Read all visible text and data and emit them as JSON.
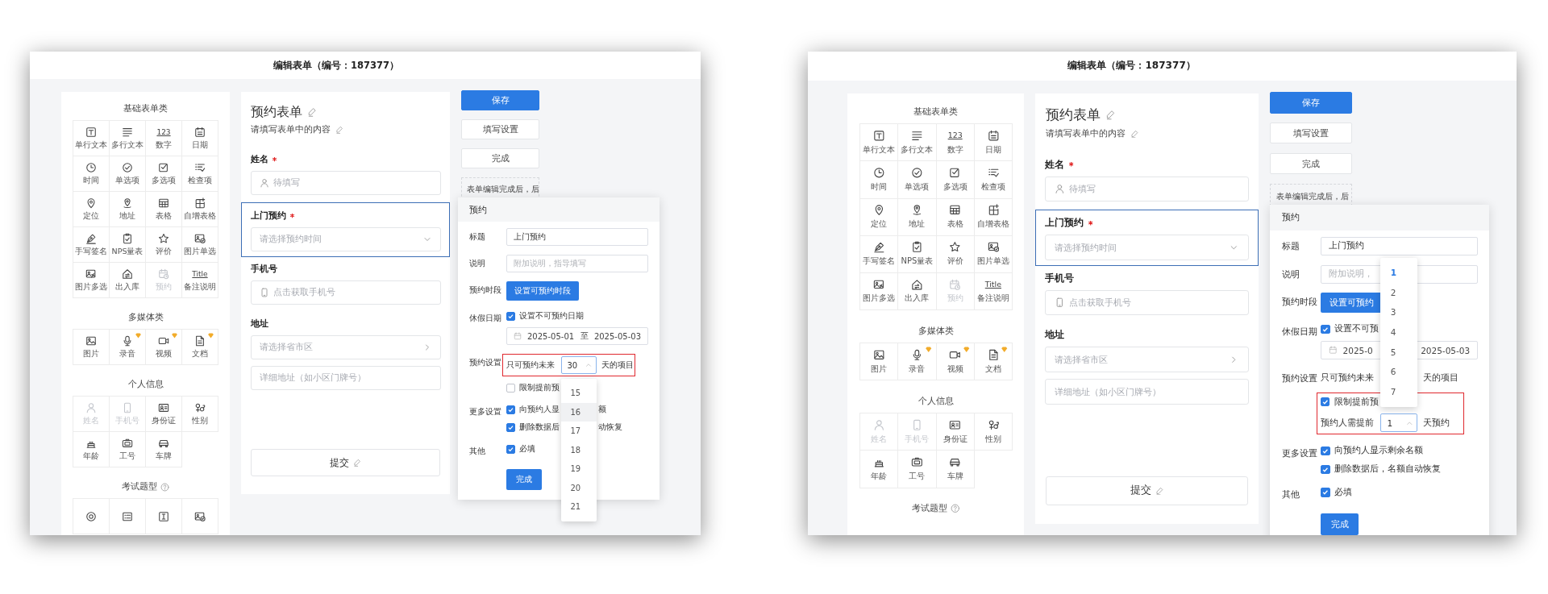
{
  "screens": [
    {
      "title": "编辑表单（编号：187377）",
      "sidebar": {
        "sections": [
          {
            "title": "基础表单类",
            "help": false,
            "items": [
              {
                "label": "单行文本",
                "kind": "text",
                "disabled": false,
                "premium": false
              },
              {
                "label": "多行文本",
                "kind": "textarea",
                "disabled": false,
                "premium": false
              },
              {
                "label": "数字",
                "glyph": "123",
                "disabled": false,
                "premium": false
              },
              {
                "label": "日期",
                "kind": "date",
                "disabled": false,
                "premium": false
              },
              {
                "label": "时间",
                "kind": "time",
                "disabled": false,
                "premium": false
              },
              {
                "label": "单选项",
                "kind": "radio",
                "disabled": false,
                "premium": false
              },
              {
                "label": "多选项",
                "kind": "checkbox",
                "disabled": false,
                "premium": false
              },
              {
                "label": "检查项",
                "kind": "checklist",
                "disabled": false,
                "premium": false
              },
              {
                "label": "定位",
                "kind": "location",
                "disabled": false,
                "premium": false
              },
              {
                "label": "地址",
                "kind": "address",
                "disabled": false,
                "premium": false
              },
              {
                "label": "表格",
                "kind": "table",
                "disabled": false,
                "premium": false
              },
              {
                "label": "自增表格",
                "kind": "add-table",
                "disabled": false,
                "premium": false
              },
              {
                "label": "手写签名",
                "kind": "signature",
                "disabled": false,
                "premium": false
              },
              {
                "label": "NPS量表",
                "kind": "nps",
                "disabled": false,
                "premium": false
              },
              {
                "label": "评价",
                "kind": "rating",
                "disabled": false,
                "premium": false
              },
              {
                "label": "图片单选",
                "kind": "image-radio",
                "disabled": false,
                "premium": false
              },
              {
                "label": "图片多选",
                "kind": "image-multi",
                "disabled": false,
                "premium": false
              },
              {
                "label": "出入库",
                "kind": "inventory",
                "disabled": false,
                "premium": false
              },
              {
                "label": "预约",
                "kind": "appointment",
                "disabled": true,
                "premium": false
              },
              {
                "label": "备注说明",
                "glyph": "Title",
                "disabled": false,
                "premium": false
              }
            ]
          },
          {
            "title": "多媒体类",
            "help": false,
            "items": [
              {
                "label": "图片",
                "kind": "image",
                "disabled": false,
                "premium": false
              },
              {
                "label": "录音",
                "kind": "audio",
                "disabled": false,
                "premium": true
              },
              {
                "label": "视频",
                "kind": "video",
                "disabled": false,
                "premium": true
              },
              {
                "label": "文档",
                "kind": "document",
                "disabled": false,
                "premium": true
              }
            ]
          },
          {
            "title": "个人信息",
            "help": false,
            "items": [
              {
                "label": "姓名",
                "kind": "person",
                "disabled": true,
                "premium": false
              },
              {
                "label": "手机号",
                "kind": "phone",
                "disabled": true,
                "premium": false
              },
              {
                "label": "身份证",
                "kind": "id-card",
                "disabled": false,
                "premium": false
              },
              {
                "label": "性别",
                "kind": "gender",
                "disabled": false,
                "premium": false
              },
              {
                "label": "年龄",
                "kind": "age",
                "disabled": false,
                "premium": false
              },
              {
                "label": "工号",
                "kind": "employee-id",
                "disabled": false,
                "premium": false
              },
              {
                "label": "车牌",
                "kind": "car",
                "disabled": false,
                "premium": false
              }
            ]
          },
          {
            "title": "考试题型",
            "help": true,
            "items": [
              {
                "kind": "exam-radio",
                "disabled": false,
                "premium": false
              },
              {
                "kind": "exam-multi",
                "disabled": false,
                "premium": false
              },
              {
                "kind": "fill-blank",
                "disabled": false,
                "premium": false
              },
              {
                "kind": "exam-image",
                "disabled": false,
                "premium": false
              }
            ]
          }
        ]
      },
      "form": {
        "title": "预约表单",
        "subtitle": "请填写表单中的内容",
        "fields": [
          {
            "label": "姓名",
            "required": true,
            "selected": false,
            "inputs": [
              {
                "kind": "person",
                "placeholder": "待填写"
              }
            ]
          },
          {
            "label": "上门预约",
            "required": true,
            "selected": true,
            "inputs": [
              {
                "kind": "select",
                "placeholder": "请选择预约时间"
              }
            ]
          },
          {
            "label": "手机号",
            "required": false,
            "selected": false,
            "inputs": [
              {
                "kind": "phone",
                "placeholder": "点击获取手机号"
              }
            ]
          },
          {
            "label": "地址",
            "required": false,
            "selected": false,
            "inputs": [
              {
                "kind": "region",
                "placeholder": "请选择省市区"
              },
              {
                "kind": "text",
                "placeholder": "详细地址（如小区门牌号）"
              }
            ]
          }
        ],
        "submit": "提交"
      },
      "actions": [
        {
          "label": "保存",
          "primary": true
        },
        {
          "label": "填写设置",
          "primary": false
        },
        {
          "label": "完成",
          "primary": false
        }
      ],
      "note": "表单编辑完成后，后",
      "popup": {
        "title": "预约",
        "rows": [
          {
            "label": "标题",
            "lines": [
              {
                "kind": "input",
                "value": "上门预约"
              }
            ]
          },
          {
            "label": "说明",
            "lines": [
              {
                "kind": "input",
                "placeholder": "附加说明，指导填写"
              }
            ]
          },
          {
            "label": "预约时段",
            "lines": [
              {
                "kind": "button",
                "text": "设置可预约时段"
              }
            ]
          },
          {
            "label": "休假日期",
            "lines": [
              {
                "kind": "check",
                "text": "设置不可预约日期",
                "checked": true
              },
              {
                "kind": "date-range",
                "start": "2025-05-01",
                "separator": "至",
                "end": "2025-05-03"
              }
            ]
          },
          {
            "label": "预约设置",
            "lines": [
              {
                "kind": "group",
                "highlighted": true,
                "lines": [
                  {
                    "kind": "number",
                    "before": "只可预约未来",
                    "value": "30",
                    "after": "天的项目",
                    "dropdown": {
                      "opens_up": false,
                      "options": [
                        {
                          "label": "15",
                          "selected": false,
                          "hovered": false
                        },
                        {
                          "label": "16",
                          "selected": false,
                          "hovered": true
                        },
                        {
                          "label": "17",
                          "selected": false,
                          "hovered": false
                        },
                        {
                          "label": "18",
                          "selected": false,
                          "hovered": false
                        },
                        {
                          "label": "19",
                          "selected": false,
                          "hovered": false
                        },
                        {
                          "label": "20",
                          "selected": false,
                          "hovered": false
                        },
                        {
                          "label": "21",
                          "selected": false,
                          "hovered": false
                        }
                      ]
                    }
                  }
                ]
              },
              {
                "kind": "check",
                "text": "限制提前预",
                "checked": false
              }
            ]
          },
          {
            "label": "更多设置",
            "lines": [
              {
                "kind": "check",
                "text": "向预约人显",
                "tail": "额",
                "checked": true
              },
              {
                "kind": "check",
                "text": "删除数据后",
                "tail": "动恢复",
                "checked": true
              }
            ]
          },
          {
            "label": "其他",
            "lines": [
              {
                "kind": "check",
                "text": "必填",
                "checked": true
              }
            ]
          },
          {
            "lines": [
              {
                "kind": "button",
                "text": "完成"
              }
            ]
          }
        ]
      }
    },
    {
      "title": "编辑表单（编号：187377）",
      "sidebar": {
        "sections": [
          {
            "title": "基础表单类",
            "help": false,
            "items": [
              {
                "label": "单行文本",
                "kind": "text",
                "disabled": false,
                "premium": false
              },
              {
                "label": "多行文本",
                "kind": "textarea",
                "disabled": false,
                "premium": false
              },
              {
                "label": "数字",
                "glyph": "123",
                "disabled": false,
                "premium": false
              },
              {
                "label": "日期",
                "kind": "date",
                "disabled": false,
                "premium": false
              },
              {
                "label": "时间",
                "kind": "time",
                "disabled": false,
                "premium": false
              },
              {
                "label": "单选项",
                "kind": "radio",
                "disabled": false,
                "premium": false
              },
              {
                "label": "多选项",
                "kind": "checkbox",
                "disabled": false,
                "premium": false
              },
              {
                "label": "检查项",
                "kind": "checklist",
                "disabled": false,
                "premium": false
              },
              {
                "label": "定位",
                "kind": "location",
                "disabled": false,
                "premium": false
              },
              {
                "label": "地址",
                "kind": "address",
                "disabled": false,
                "premium": false
              },
              {
                "label": "表格",
                "kind": "table",
                "disabled": false,
                "premium": false
              },
              {
                "label": "自增表格",
                "kind": "add-table",
                "disabled": false,
                "premium": false
              },
              {
                "label": "手写签名",
                "kind": "signature",
                "disabled": false,
                "premium": false
              },
              {
                "label": "NPS量表",
                "kind": "nps",
                "disabled": false,
                "premium": false
              },
              {
                "label": "评价",
                "kind": "rating",
                "disabled": false,
                "premium": false
              },
              {
                "label": "图片单选",
                "kind": "image-radio",
                "disabled": false,
                "premium": false
              },
              {
                "label": "图片多选",
                "kind": "image-multi",
                "disabled": false,
                "premium": false
              },
              {
                "label": "出入库",
                "kind": "inventory",
                "disabled": false,
                "premium": false
              },
              {
                "label": "预约",
                "kind": "appointment",
                "disabled": true,
                "premium": false
              },
              {
                "label": "备注说明",
                "glyph": "Title",
                "disabled": false,
                "premium": false
              }
            ]
          },
          {
            "title": "多媒体类",
            "help": false,
            "items": [
              {
                "label": "图片",
                "kind": "image",
                "disabled": false,
                "premium": false
              },
              {
                "label": "录音",
                "kind": "audio",
                "disabled": false,
                "premium": true
              },
              {
                "label": "视频",
                "kind": "video",
                "disabled": false,
                "premium": true
              },
              {
                "label": "文档",
                "kind": "document",
                "disabled": false,
                "premium": true
              }
            ]
          },
          {
            "title": "个人信息",
            "help": false,
            "items": [
              {
                "label": "姓名",
                "kind": "person",
                "disabled": true,
                "premium": false
              },
              {
                "label": "手机号",
                "kind": "phone",
                "disabled": true,
                "premium": false
              },
              {
                "label": "身份证",
                "kind": "id-card",
                "disabled": false,
                "premium": false
              },
              {
                "label": "性别",
                "kind": "gender",
                "disabled": false,
                "premium": false
              },
              {
                "label": "年龄",
                "kind": "age",
                "disabled": false,
                "premium": false
              },
              {
                "label": "工号",
                "kind": "employee-id",
                "disabled": false,
                "premium": false
              },
              {
                "label": "车牌",
                "kind": "car",
                "disabled": false,
                "premium": false
              }
            ]
          },
          {
            "title": "考试题型",
            "help": true
          }
        ]
      },
      "form": {
        "title": "预约表单",
        "subtitle": "请填写表单中的内容",
        "fields": [
          {
            "label": "姓名",
            "required": true,
            "selected": false,
            "inputs": [
              {
                "kind": "person",
                "placeholder": "待填写"
              }
            ]
          },
          {
            "label": "上门预约",
            "required": true,
            "selected": true,
            "inputs": [
              {
                "kind": "select",
                "placeholder": "请选择预约时间"
              }
            ]
          },
          {
            "label": "手机号",
            "required": false,
            "selected": false,
            "inputs": [
              {
                "kind": "phone",
                "placeholder": "点击获取手机号"
              }
            ]
          },
          {
            "label": "地址",
            "required": false,
            "selected": false,
            "inputs": [
              {
                "kind": "region",
                "placeholder": "请选择省市区"
              },
              {
                "kind": "text",
                "placeholder": "详细地址（如小区门牌号）"
              }
            ]
          }
        ],
        "submit": "提交"
      },
      "actions": [
        {
          "label": "保存",
          "primary": true
        },
        {
          "label": "填写设置",
          "primary": false
        },
        {
          "label": "完成",
          "primary": false
        }
      ],
      "note": "表单编辑完成后，后",
      "popup": {
        "title": "预约",
        "rows": [
          {
            "label": "标题",
            "lines": [
              {
                "kind": "input",
                "value": "上门预约"
              }
            ]
          },
          {
            "label": "说明",
            "lines": [
              {
                "kind": "input",
                "placeholder": "附加说明，"
              }
            ]
          },
          {
            "label": "预约时段",
            "lines": [
              {
                "kind": "button",
                "text": "设置可预约"
              }
            ]
          },
          {
            "label": "休假日期",
            "lines": [
              {
                "kind": "check",
                "text": "设置不可预",
                "checked": true
              },
              {
                "kind": "date-range",
                "start": "2025-0",
                "end": "2025-05-03"
              }
            ]
          },
          {
            "label": "预约设置",
            "lines": [
              {
                "kind": "number",
                "before": "只可预约未来",
                "after": "天的项目"
              },
              {
                "kind": "group",
                "highlighted": true,
                "lines": [
                  {
                    "kind": "check",
                    "text": "限制提前预",
                    "checked": true
                  },
                  {
                    "kind": "number",
                    "before": "预约人需提前",
                    "value": "1",
                    "after": "天预约",
                    "dropdown": {
                      "opens_up": true,
                      "options": [
                        {
                          "label": "1",
                          "selected": true,
                          "hovered": false
                        },
                        {
                          "label": "2",
                          "selected": false,
                          "hovered": false
                        },
                        {
                          "label": "3",
                          "selected": false,
                          "hovered": false
                        },
                        {
                          "label": "4",
                          "selected": false,
                          "hovered": false
                        },
                        {
                          "label": "5",
                          "selected": false,
                          "hovered": false
                        },
                        {
                          "label": "6",
                          "selected": false,
                          "hovered": false
                        },
                        {
                          "label": "7",
                          "selected": false,
                          "hovered": false
                        }
                      ]
                    }
                  }
                ]
              }
            ]
          },
          {
            "label": "更多设置",
            "lines": [
              {
                "kind": "check",
                "text": "向预约人显示剩余名额",
                "checked": true
              },
              {
                "kind": "check",
                "text": "删除数据后，名额自动恢复",
                "checked": true
              }
            ]
          },
          {
            "label": "其他",
            "lines": [
              {
                "kind": "check",
                "text": "必填",
                "checked": true
              }
            ]
          },
          {
            "lines": [
              {
                "kind": "button",
                "text": "完成"
              }
            ]
          }
        ]
      }
    }
  ]
}
